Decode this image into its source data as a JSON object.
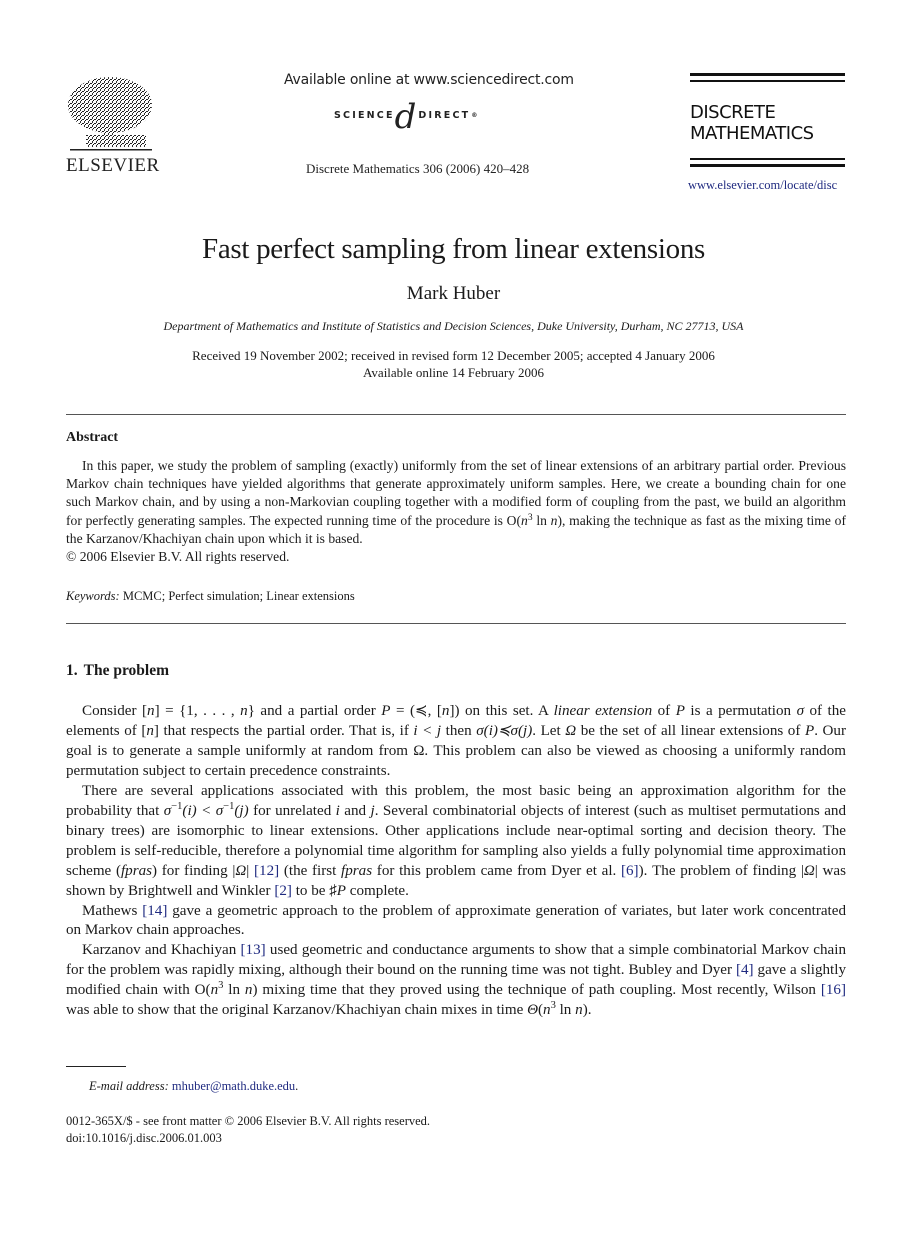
{
  "header": {
    "publisher_logo_label": "ELSEVIER",
    "available_online": "Available online at www.sciencedirect.com",
    "sciencedirect": {
      "left": "SCIENCE",
      "mark": "d",
      "right": "DIRECT",
      "reg": "®"
    },
    "journal_reference": "Discrete Mathematics 306 (2006) 420–428",
    "journal_title_line1": "DISCRETE",
    "journal_title_line2": "MATHEMATICS",
    "journal_url": "www.elsevier.com/locate/disc"
  },
  "article": {
    "title": "Fast perfect sampling from linear extensions",
    "author": "Mark Huber",
    "affiliation": "Department of Mathematics and Institute of Statistics and Decision Sciences, Duke University, Durham, NC 27713, USA",
    "received": "Received 19 November 2002; received in revised form 12 December 2005; accepted 4 January 2006",
    "available_online": "Available online 14 February 2006"
  },
  "abstract": {
    "heading": "Abstract",
    "text_a": "In this paper, we study the problem of sampling (exactly) uniformly from the set of linear extensions of an arbitrary partial order. Previous Markov chain techniques have yielded algorithms that generate approximately uniform samples. Here, we create a bounding chain for one such Markov chain, and by using a non-Markovian coupling together with a modified form of coupling from the past, we build an algorithm for perfectly generating samples. The expected running time of the procedure is O(",
    "text_n": "n",
    "text_sup": "3",
    "text_ln": " ln ",
    "text_n2": "n",
    "text_b": "), making the technique as fast as the mixing time of the Karzanov/Khachiyan chain upon which it is based.",
    "copyright": "© 2006 Elsevier B.V. All rights reserved."
  },
  "keywords": {
    "label": "Keywords:",
    "values": "MCMC; Perfect simulation; Linear extensions"
  },
  "section1": {
    "number": "1.",
    "title": "The problem",
    "p1": {
      "a": "Consider  [",
      "n1": "n",
      "b": "] = {1, . . . , ",
      "n2": "n",
      "c": "} and a partial order ",
      "P1": "P",
      "d": " = (≼, [",
      "n3": "n",
      "e": "]) on this set. A ",
      "le": "linear extension",
      "f": " of ",
      "P2": "P",
      "g": " is a permutation ",
      "sigma": "σ",
      "h": " of the elements of [",
      "n4": "n",
      "i": "] that respects the partial order. That is, if ",
      "ij": "i < j",
      "j": " then ",
      "sig_ij": "σ(i)≼σ(j)",
      "k": ". Let ",
      "omega1": "Ω",
      "l": " be the set of all linear extensions of ",
      "P3": "P",
      "m": ". Our goal is to generate a sample uniformly at random from Ω. This problem can also be viewed as choosing a uniformly random permutation subject to certain precedence constraints."
    },
    "p2": {
      "a": "There are several applications associated with this problem, the most basic being an approximation algorithm for the probability that ",
      "s1": "σ",
      "sup1": "−1",
      "s1b": "(i) < ",
      "s2": "σ",
      "sup2": "−1",
      "s2b": "(j)",
      "b": " for unrelated ",
      "i": "i",
      "c": " and ",
      "j": "j",
      "d": ". Several combinatorial objects of interest (such as multiset permutations and binary trees) are isomorphic to linear extensions. Other applications include near-optimal sorting and decision theory. The problem is self-reducible, therefore a polynomial time algorithm for sampling also yields a fully polynomial time approximation scheme (",
      "fpras1": "fpras",
      "e": ") for finding |",
      "omega": "Ω",
      "f": "| ",
      "cite12": "[12]",
      "g": " (the first ",
      "fpras2": "fpras",
      "h": " for this problem came from Dyer et al. ",
      "cite6": "[6]",
      "k": "). The problem of finding |",
      "omega2": "Ω",
      "l": "| was shown by Brightwell and Winkler ",
      "cite2": "[2]",
      "m": " to be ♯",
      "P": "P",
      "n": "  complete."
    },
    "p3": {
      "a": "Mathews ",
      "cite14": "[14]",
      "b": " gave a geometric approach to the problem of approximate generation of variates, but later work concentrated on Markov chain approaches."
    },
    "p4": {
      "a": "Karzanov and Khachiyan ",
      "cite13": "[13]",
      "b": " used geometric and conductance arguments to show that a simple combinatorial Markov chain for the problem was rapidly mixing, although their bound on the running time was not tight. Bubley and Dyer ",
      "cite4": "[4]",
      "c": " gave a slightly modified chain with O(",
      "n": "n",
      "sup": "3",
      "ln": " ln ",
      "n2": "n",
      "d": ") mixing time that they proved using the technique of path coupling. Most recently, Wilson ",
      "cite16": "[16]",
      "e": " was able to show that the original Karzanov/Khachiyan chain mixes in time ",
      "theta": "Θ",
      "f": "(",
      "n3": "n",
      "sup2": "3",
      "ln2": " ln ",
      "n4": "n",
      "g": ")."
    }
  },
  "footnote": {
    "label": "E-mail address:",
    "email": "mhuber@math.duke.edu",
    "trail": "."
  },
  "front_matter": {
    "line1": "0012-365X/$ - see front matter © 2006 Elsevier B.V. All rights reserved.",
    "line2": "doi:10.1016/j.disc.2006.01.003"
  },
  "colors": {
    "link": "#1f2a80",
    "text": "#1a1a1a",
    "rule": "#555555"
  }
}
